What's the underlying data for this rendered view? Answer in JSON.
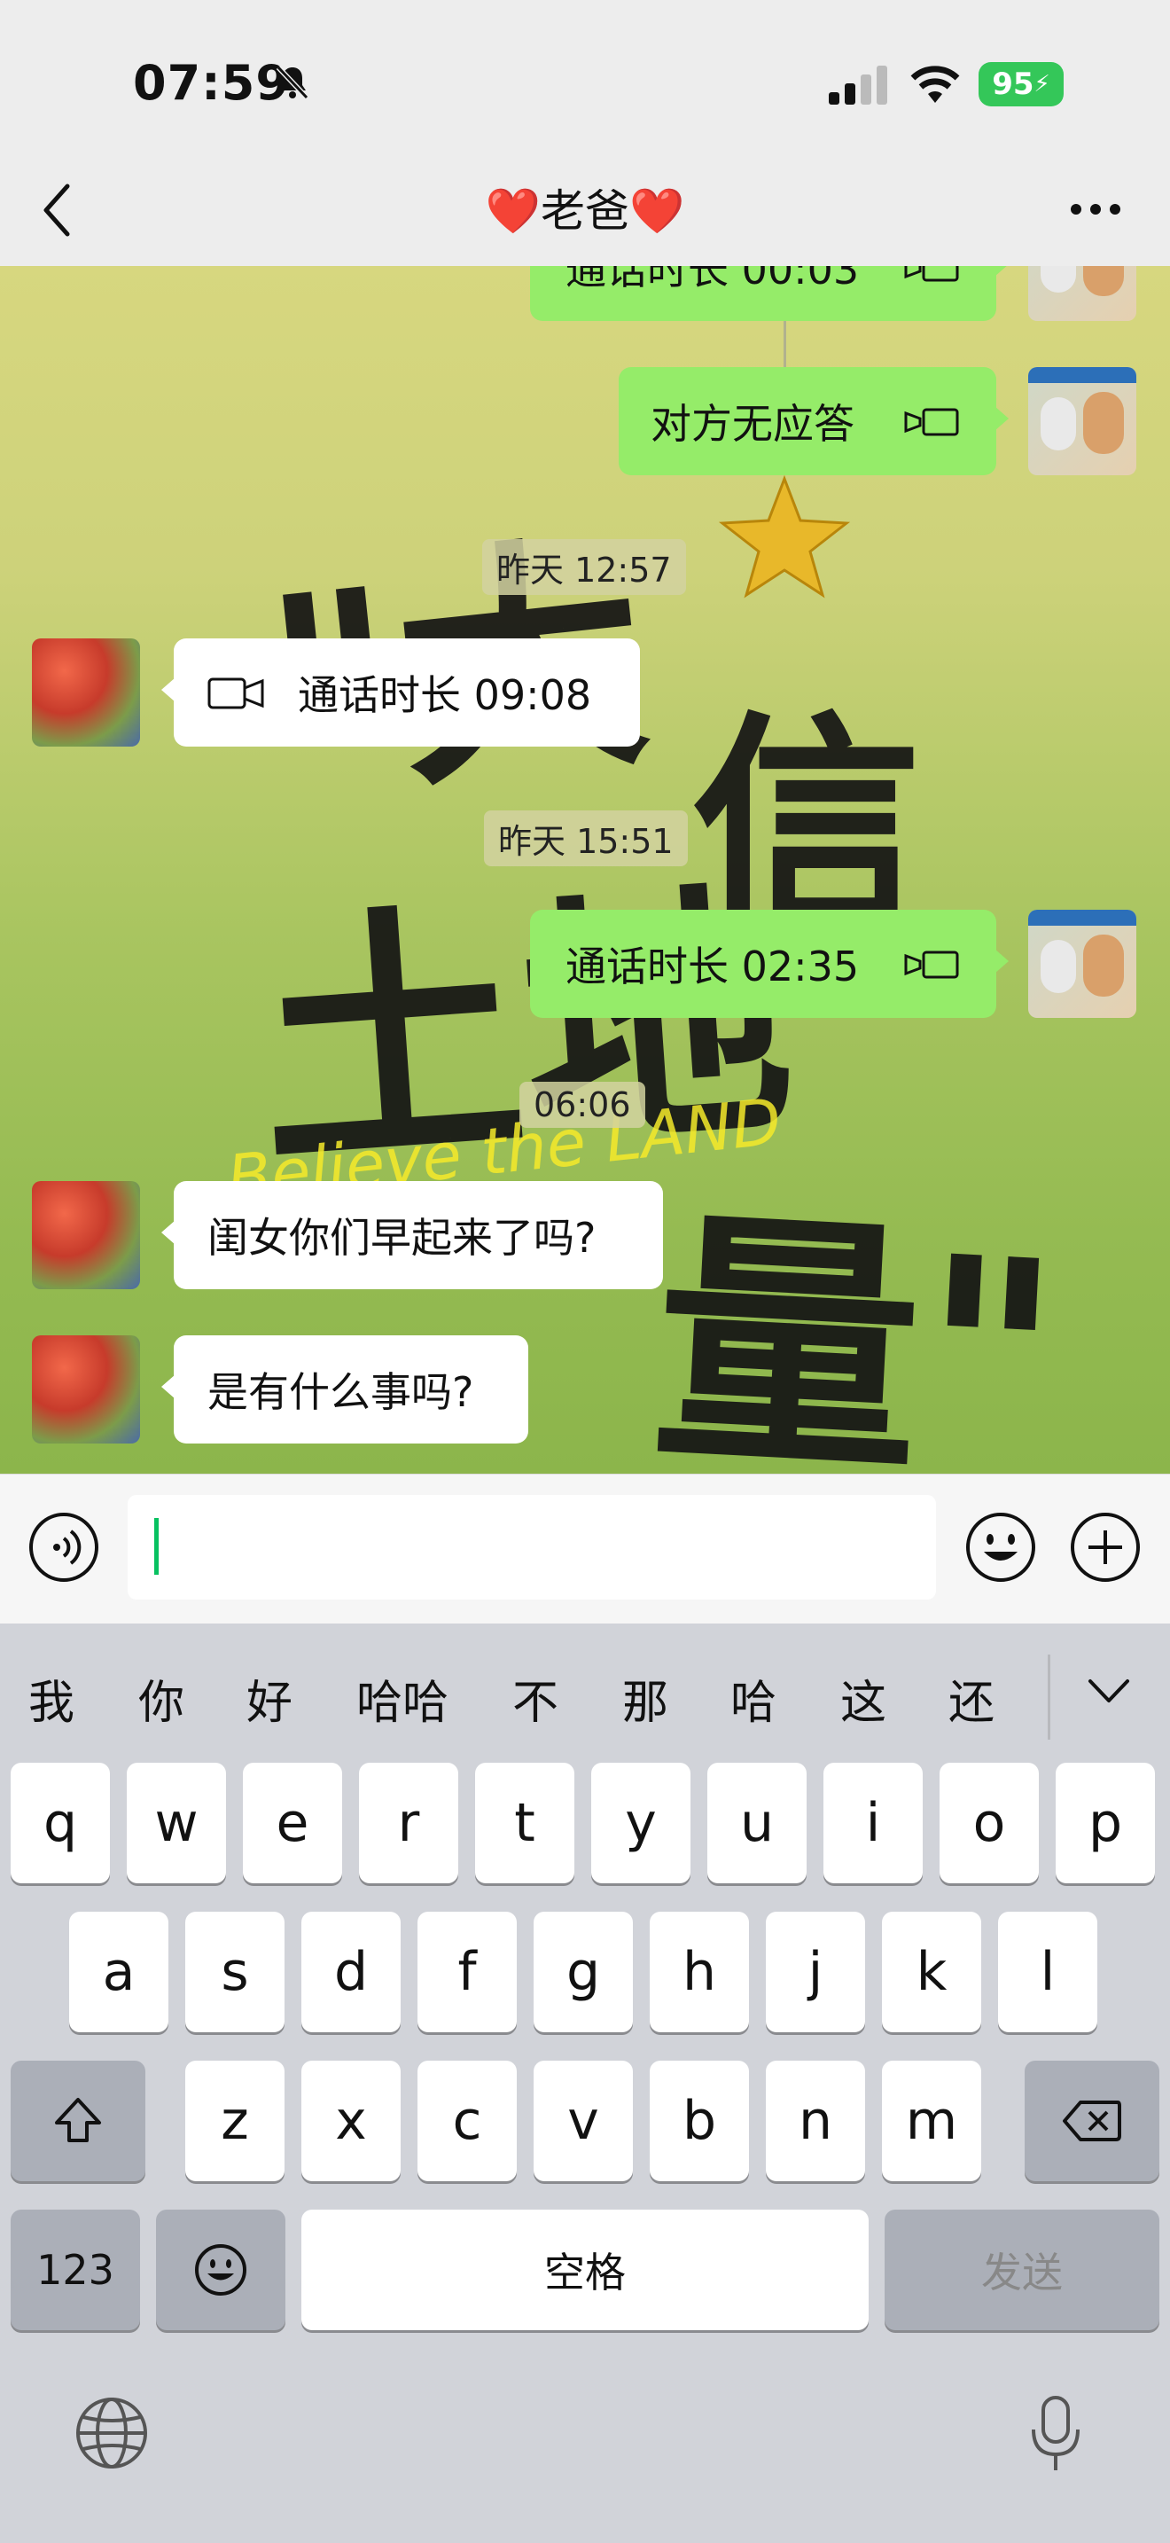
{
  "status": {
    "time": "07:59",
    "battery": "95"
  },
  "header": {
    "title": "老爸",
    "heart": "❤️"
  },
  "messages": [
    {
      "text": "通话时长 00:03"
    },
    {
      "text": "对方无应答"
    },
    {
      "timestamp": "昨天 12:57"
    },
    {
      "text": "通话时长 09:08"
    },
    {
      "timestamp": "昨天 15:51"
    },
    {
      "text": "通话时长 02:35"
    },
    {
      "timestamp": "06:06"
    },
    {
      "text": "闺女你们早起来了吗?"
    },
    {
      "text": "是有什么事吗?"
    }
  ],
  "candidates": [
    "我",
    "你",
    "好",
    "哈哈",
    "不",
    "那",
    "哈",
    "这",
    "还"
  ],
  "keyboard": {
    "row1": [
      "q",
      "w",
      "e",
      "r",
      "t",
      "y",
      "u",
      "i",
      "o",
      "p"
    ],
    "row2": [
      "a",
      "s",
      "d",
      "f",
      "g",
      "h",
      "j",
      "k",
      "l"
    ],
    "row3": [
      "z",
      "x",
      "c",
      "v",
      "b",
      "n",
      "m"
    ],
    "num": "123",
    "space": "空格",
    "send": "发送"
  },
  "colors": {
    "my_bubble": "#95ec69",
    "other_bubble": "#ffffff",
    "accent": "#07c160"
  }
}
